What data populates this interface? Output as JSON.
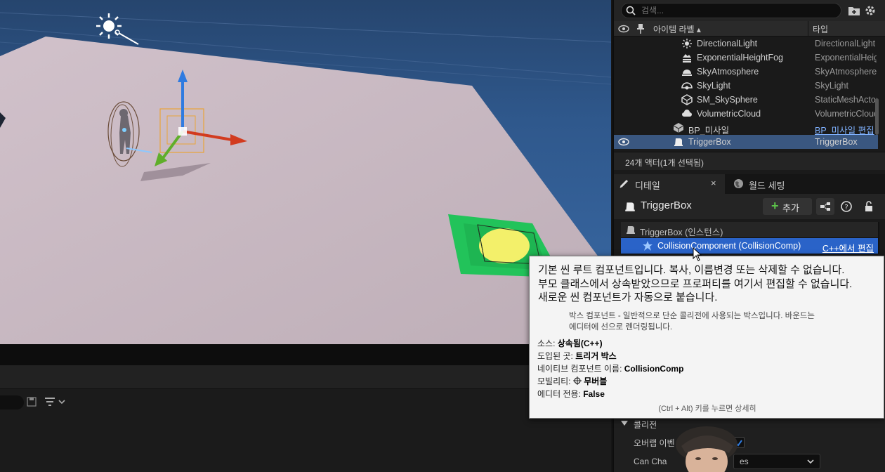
{
  "outliner": {
    "search_placeholder": "검색...",
    "col_label": "아이템 라벨 ▴",
    "col_type": "타입",
    "rows": [
      {
        "name": "DirectionalLight",
        "type": "DirectionalLight",
        "icon": "sun-icon"
      },
      {
        "name": "ExponentialHeightFog",
        "type": "ExponentialHeightFog",
        "icon": "fog-icon"
      },
      {
        "name": "SkyAtmosphere",
        "type": "SkyAtmosphere",
        "icon": "sky-atmosphere-icon"
      },
      {
        "name": "SkyLight",
        "type": "SkyLight",
        "icon": "sky-light-icon"
      },
      {
        "name": "SM_SkySphere",
        "type": "StaticMeshActor",
        "icon": "static-mesh-icon"
      },
      {
        "name": "VolumetricCloud",
        "type": "VolumetricCloud",
        "icon": "cloud-icon"
      },
      {
        "name": "BP_미사일",
        "type": "BP_미사일 편집",
        "icon": "blueprint-icon"
      },
      {
        "name": "TriggerBox",
        "type": "TriggerBox",
        "icon": "trigger-box-icon"
      }
    ],
    "actor_count": "24개 액터(1개 선택됨)"
  },
  "tabs": {
    "details": "디테일",
    "world_settings": "월드 세팅",
    "close": "×"
  },
  "details": {
    "title": "TriggerBox",
    "add_label": "추가",
    "instance_row": "TriggerBox (인스턴스)",
    "component_row": "CollisionComponent (CollisionComp)",
    "edit_cpp": "C++에서 편집",
    "section": "콜리전",
    "prop_overlap": "오버랩 이벤",
    "prop_can_char": "Can Cha",
    "combo_value": "es"
  },
  "tooltip": {
    "line1": "기본 씬 루트 컴포넌트입니다. 복사, 이름변경 또는 삭제할 수 없습니다.",
    "line2": "부모 클래스에서 상속받았으므로 프로퍼티를 여기서 편집할 수 없습니다.",
    "line3": "새로운 씬 컴포넌트가 자동으로 붙습니다.",
    "desc_line1": "박스 컴포넌트 - 일반적으로 단순 콜리전에 사용되는 박스입니다. 바운드는",
    "desc_line2": "에디터에 선으로 렌더링됩니다.",
    "source_label": "소스:",
    "source_value": "상속됨(C++)",
    "introduced_label": "도입된 곳:",
    "introduced_value": "트리거 박스",
    "native_label": "네이티브 컴포넌트 이름:",
    "native_value": "CollisionComp",
    "mobility_label": "모빌리티:",
    "mobility_value": "무버블",
    "editor_only_label": "에디터 전용:",
    "editor_only_value": "False",
    "hint": "(Ctrl + Alt) 키를 누르면 상세히"
  },
  "colors": {
    "selection": "#3a5780",
    "component_selected": "#2a63c8",
    "gizmo_x": "#d23b1f",
    "gizmo_y": "#5fae2a",
    "gizmo_z": "#2f7be0",
    "trigger_pad": "#22c35a"
  }
}
